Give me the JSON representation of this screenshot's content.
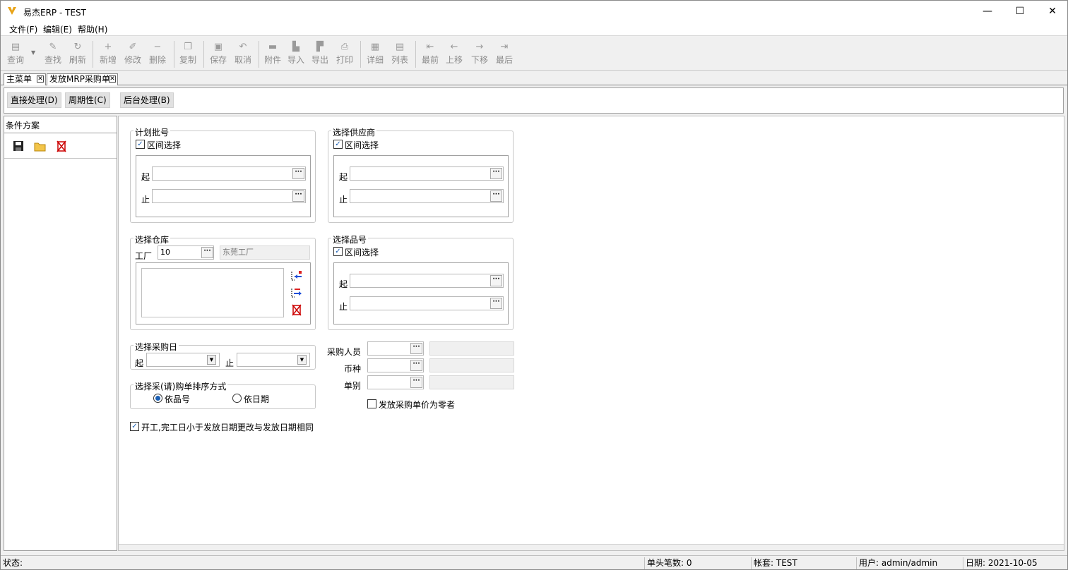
{
  "window": {
    "title": "易杰ERP - TEST",
    "minimize": "—",
    "maximize": "☐",
    "close": "✕"
  },
  "menu": [
    "文件(F)",
    "编辑(E)",
    "帮助(H)"
  ],
  "toolbar": {
    "query": "查询",
    "find": "查找",
    "refresh": "刷新",
    "add": "新增",
    "edit": "修改",
    "delete": "删除",
    "copy": "复制",
    "save": "保存",
    "cancel": "取消",
    "attach": "附件",
    "import": "导入",
    "export": "导出",
    "print": "打印",
    "detail": "详细",
    "list": "列表",
    "first": "最前",
    "prev": "上移",
    "next": "下移",
    "last": "最后"
  },
  "tabs": [
    "主菜单",
    "发放MRP采购单"
  ],
  "actions": {
    "direct": "直接处理(D)",
    "periodic": "周期性(C)",
    "background": "后台处理(B)"
  },
  "left": {
    "header": "条件方案"
  },
  "plan": {
    "title": "计划批号",
    "range": "区间选择",
    "from": "起",
    "to": "止",
    "from_val": "",
    "to_val": ""
  },
  "supplier": {
    "title": "选择供应商",
    "range": "区间选择",
    "from": "起",
    "to": "止",
    "from_val": "",
    "to_val": ""
  },
  "warehouse": {
    "title": "选择仓库",
    "factory_label": "工厂",
    "factory_code": "10",
    "factory_name": "东莞工厂"
  },
  "item": {
    "title": "选择品号",
    "range": "区间选择",
    "from": "起",
    "to": "止",
    "from_val": "",
    "to_val": ""
  },
  "purchase_date": {
    "title": "选择采购日",
    "from": "起",
    "to": "止",
    "from_val": "",
    "to_val": ""
  },
  "sort": {
    "title": "选择采(请)购单排序方式",
    "by_item": "依品号",
    "by_date": "依日期",
    "selected": "by_item"
  },
  "fields": {
    "buyer": "采购人员",
    "currency": "币种",
    "doc_type": "单别",
    "buyer_val": "",
    "currency_val": "",
    "doc_type_val": ""
  },
  "zero_price": {
    "label": "发放采购单价为零者",
    "checked": false
  },
  "same_date": {
    "label": "开工,完工日小于发放日期更改与发放日期相同",
    "checked": true
  },
  "status": {
    "state": "状态:",
    "headcount": "单头笔数: 0",
    "account": "帐套: TEST",
    "user": "用户: admin/admin",
    "date": "日期: 2021-10-05"
  },
  "colors": {
    "accent": "#1a5fb4",
    "titleicon": "#e8a317"
  }
}
